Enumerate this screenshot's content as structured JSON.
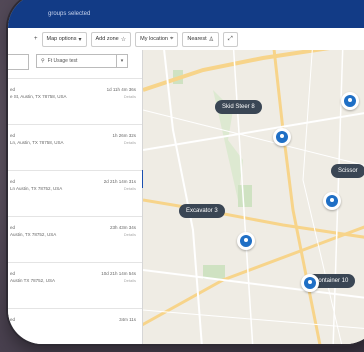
{
  "topbar": {
    "selection_text": "groups selected"
  },
  "toolbar": {
    "map_options": "Map options",
    "add_zone": "Add zone",
    "my_location": "My location",
    "nearest": "Nearest"
  },
  "sidebar": {
    "filter_placeholder": "Ft Usage test",
    "items": [
      {
        "label": "ed",
        "time": "1d 11h 4m 36s",
        "address": "e St, Austin, TX 78758, USA",
        "detail": "Details"
      },
      {
        "label": "ed",
        "time": "1h 26m 32s",
        "address": "Ln, Austin, TX 78758, USA",
        "detail": "Details"
      },
      {
        "label": "ed",
        "time": "2d 21h 14m 31s",
        "address": "Ln Austin, TX 78752, USA",
        "detail": "Details"
      },
      {
        "label": "ed",
        "time": "23h 43m 34s",
        "address": "Austin, TX 78752, USA",
        "detail": "Details"
      },
      {
        "label": "ed",
        "time": "10d 21h 14m 54s",
        "address": "Austin TX 78752, USA",
        "detail": "Details"
      },
      {
        "label": "ed",
        "time": "34m 11s",
        "address": "",
        "detail": ""
      }
    ]
  },
  "map": {
    "pins": [
      {
        "name": "Skid Steer 8"
      },
      {
        "name": "Excavator 3"
      },
      {
        "name": "Scissor"
      },
      {
        "name": "Container 10"
      },
      {
        "name": "C"
      }
    ]
  }
}
